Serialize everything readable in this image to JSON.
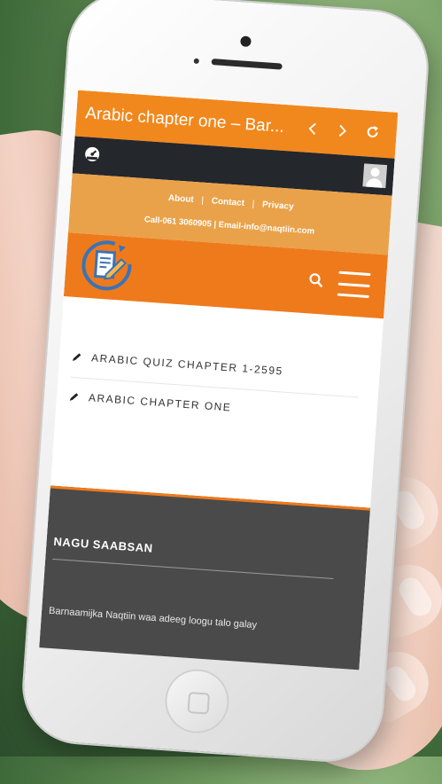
{
  "browser": {
    "title": "Arabic chapter one – Bar...",
    "back_icon": "chevron-left-icon",
    "forward_icon": "chevron-right-icon",
    "reload_icon": "reload-icon",
    "accent_color": "#f0881e"
  },
  "admin_bar": {
    "dashboard_icon": "dashboard-icon",
    "avatar_icon": "user-avatar-icon"
  },
  "top_links": {
    "items": [
      "About",
      "Contact",
      "Privacy"
    ],
    "separator": "|",
    "contact_line": "Call-061 3060905 | Email-info@naqtiin.com"
  },
  "header": {
    "logo_icon": "document-pen-logo-icon",
    "search_icon": "search-icon",
    "menu_icon": "hamburger-menu-icon",
    "accent_color": "#ef7a1c"
  },
  "content": {
    "posts": [
      {
        "icon": "pencil-icon",
        "label": "ARABIC QUIZ CHAPTER 1-2595"
      },
      {
        "icon": "pencil-icon",
        "label": "ARABIC CHAPTER ONE"
      }
    ]
  },
  "footer": {
    "heading": "NAGU SAABSAN",
    "text": "Barnaamijka Naqtiin waa adeeg loogu talo galay"
  }
}
